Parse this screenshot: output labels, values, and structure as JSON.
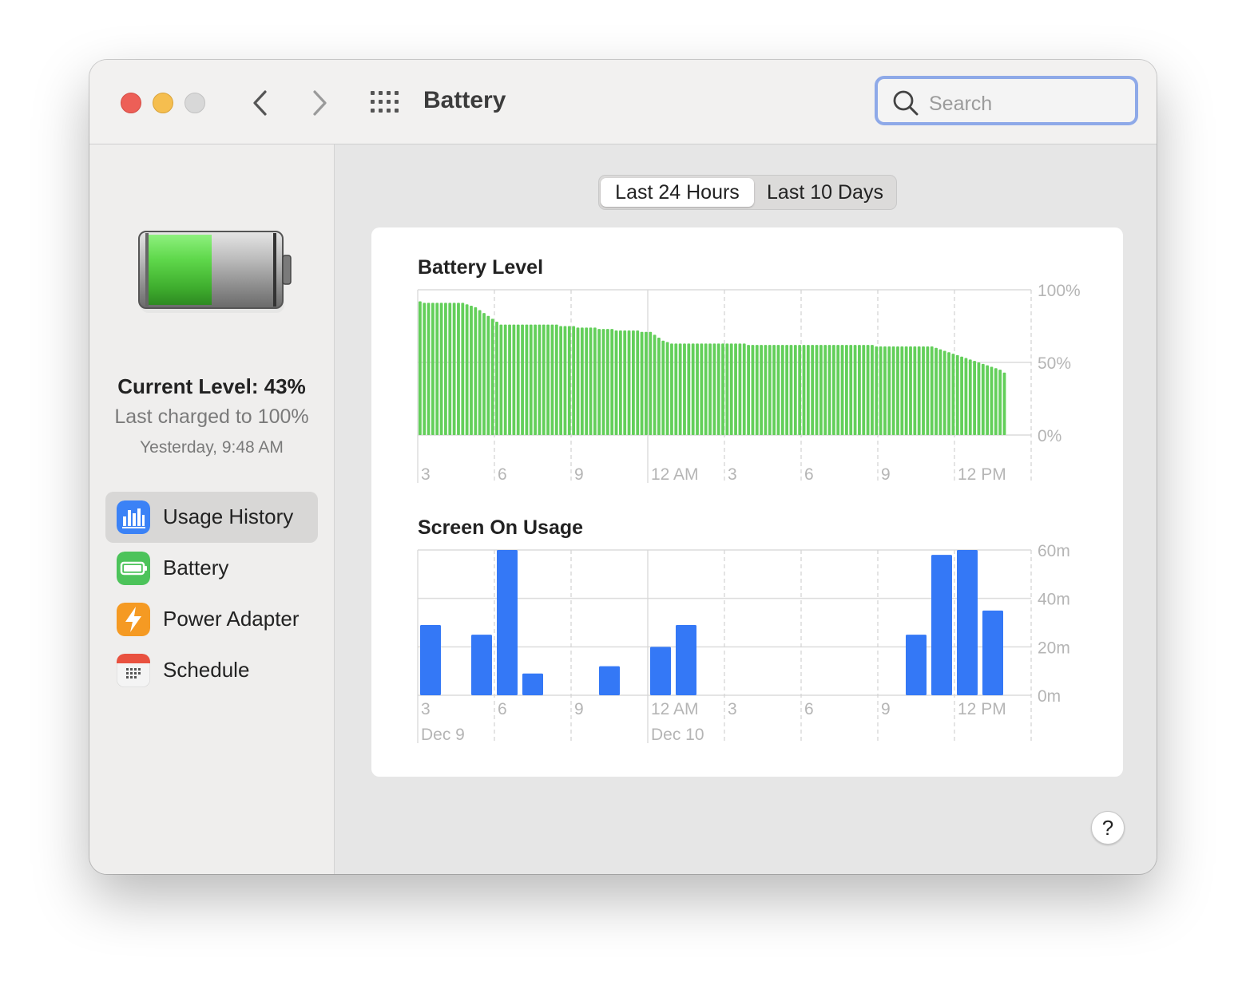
{
  "window": {
    "title": "Battery"
  },
  "search": {
    "placeholder": "Search"
  },
  "sidebar": {
    "current_level": "Current Level: 43%",
    "last_charged": "Last charged to 100%",
    "charged_time": "Yesterday, 9:48 AM",
    "battery_icon_level": 0.43,
    "items": [
      {
        "label": "Usage History",
        "icon": "bar-chart-icon",
        "color": "#3b82f6",
        "selected": true
      },
      {
        "label": "Battery",
        "icon": "battery-icon",
        "color": "#4cc35a",
        "selected": false
      },
      {
        "label": "Power Adapter",
        "icon": "bolt-icon",
        "color": "#f59a23",
        "selected": false
      },
      {
        "label": "Schedule",
        "icon": "calendar-icon",
        "color": "#e9513f",
        "selected": false
      }
    ]
  },
  "segmented": {
    "active": "Last 24 Hours",
    "inactive": "Last 10 Days"
  },
  "help": {
    "label": "?"
  },
  "colors": {
    "battery_green": "#63cf5a",
    "screen_blue": "#3478f6",
    "accent": "#8ea9e8"
  },
  "chart_data": [
    {
      "type": "bar",
      "title": "Battery Level",
      "x_ticks": [
        "3",
        "6",
        "9",
        "12 AM",
        "3",
        "6",
        "9",
        "12 PM"
      ],
      "y_ticks": [
        "100%",
        "50%",
        "0%"
      ],
      "ylim": [
        0,
        100
      ],
      "grid": true,
      "values": [
        92,
        91,
        91,
        91,
        91,
        91,
        91,
        91,
        91,
        91,
        91,
        90,
        89,
        88,
        86,
        84,
        82,
        80,
        78,
        76,
        76,
        76,
        76,
        76,
        76,
        76,
        76,
        76,
        76,
        76,
        76,
        76,
        76,
        75,
        75,
        75,
        75,
        74,
        74,
        74,
        74,
        74,
        73,
        73,
        73,
        73,
        72,
        72,
        72,
        72,
        72,
        72,
        71,
        71,
        71,
        69,
        67,
        65,
        64,
        63,
        63,
        63,
        63,
        63,
        63,
        63,
        63,
        63,
        63,
        63,
        63,
        63,
        63,
        63,
        63,
        63,
        63,
        62,
        62,
        62,
        62,
        62,
        62,
        62,
        62,
        62,
        62,
        62,
        62,
        62,
        62,
        62,
        62,
        62,
        62,
        62,
        62,
        62,
        62,
        62,
        62,
        62,
        62,
        62,
        62,
        62,
        62,
        61,
        61,
        61,
        61,
        61,
        61,
        61,
        61,
        61,
        61,
        61,
        61,
        61,
        61,
        60,
        59,
        58,
        57,
        56,
        55,
        54,
        53,
        52,
        51,
        50,
        49,
        48,
        47,
        46,
        45,
        43
      ]
    },
    {
      "type": "bar",
      "title": "Screen On Usage",
      "x_ticks": [
        "3",
        "6",
        "9",
        "12 AM",
        "3",
        "6",
        "9",
        "12 PM"
      ],
      "date_labels": [
        "Dec 9",
        "Dec 10"
      ],
      "y_ticks": [
        "60m",
        "40m",
        "20m",
        "0m"
      ],
      "ylim": [
        0,
        60
      ],
      "grid": true,
      "values": [
        29,
        0,
        25,
        60,
        9,
        0,
        0,
        12,
        0,
        20,
        29,
        0,
        0,
        0,
        0,
        0,
        0,
        0,
        0,
        25,
        58,
        60,
        35,
        0
      ]
    }
  ]
}
